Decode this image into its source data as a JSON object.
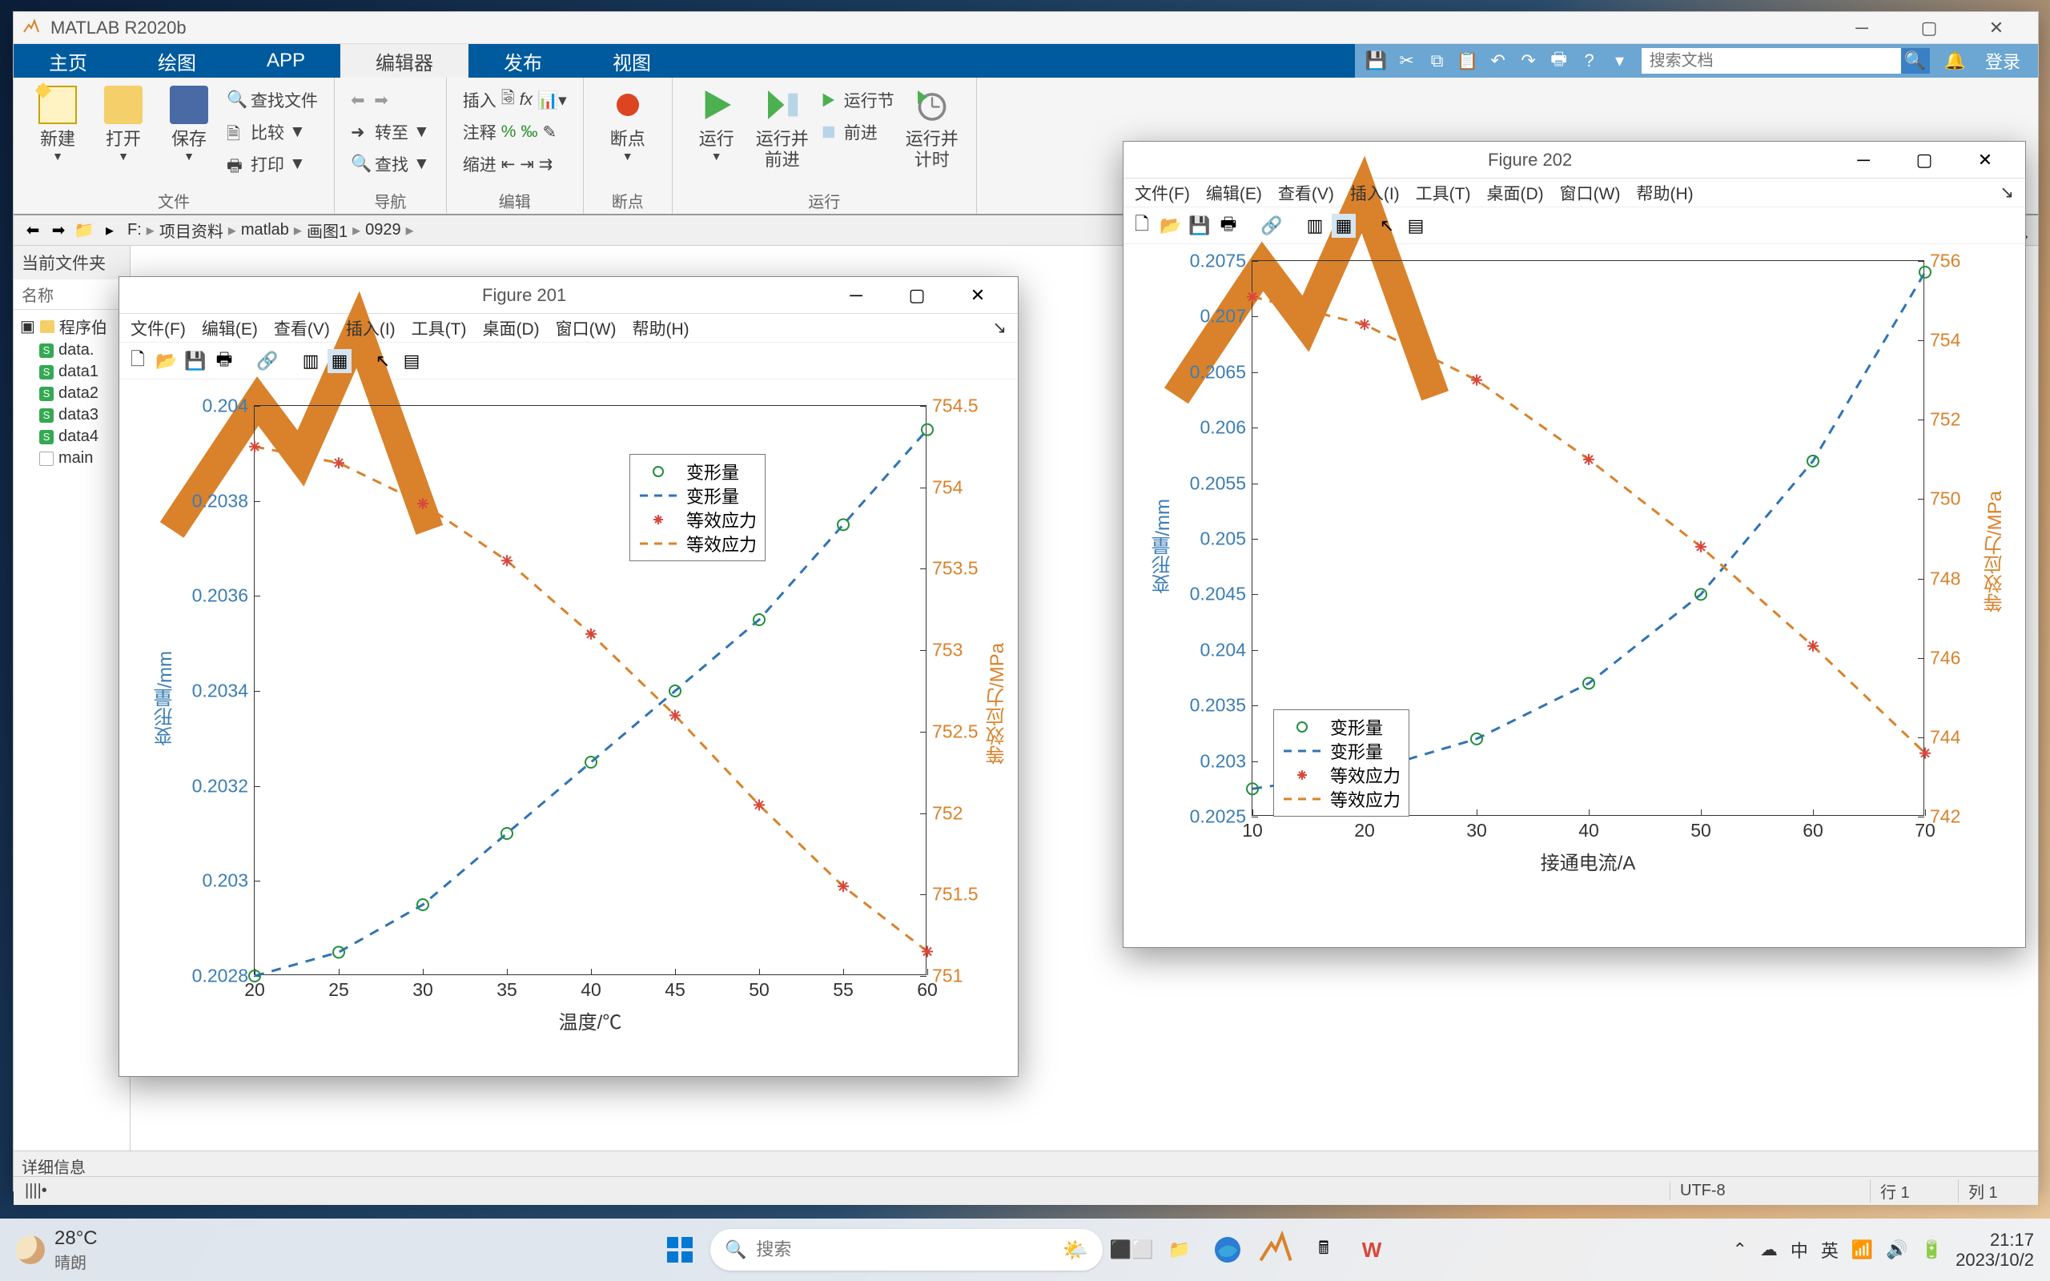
{
  "app": {
    "title": "MATLAB R2020b"
  },
  "tabs": [
    "主页",
    "绘图",
    "APP",
    "编辑器",
    "发布",
    "视图"
  ],
  "active_tab": 3,
  "search_placeholder": "搜索文档",
  "login": "登录",
  "ribbon": {
    "groups": {
      "file": {
        "label": "文件",
        "btns": [
          "新建",
          "打开",
          "保存"
        ],
        "rows": [
          "查找文件",
          "比较",
          "打印"
        ]
      },
      "nav": {
        "label": "导航",
        "rows": [
          "转至",
          "查找"
        ]
      },
      "edit": {
        "label": "编辑",
        "head": [
          "插入",
          "注释",
          "缩进"
        ]
      },
      "break": {
        "label": "断点",
        "btn": "断点"
      },
      "run": {
        "label": "运行",
        "btns": [
          "运行",
          "运行并前进",
          "运行并计时"
        ],
        "rows": [
          "运行节",
          "前进"
        ]
      }
    }
  },
  "path": {
    "drive": "F:",
    "segs": [
      "项目资料",
      "matlab",
      "画图1",
      "0929"
    ]
  },
  "sidebar": {
    "title": "当前文件夹",
    "col": "名称",
    "folder": "程序伯",
    "files": [
      "data.",
      "data1",
      "data2",
      "data3",
      "data4",
      "main"
    ]
  },
  "details": "详细信息",
  "linecol": {
    "encoding": "UTF-8",
    "line": "行 1",
    "col": "列 1"
  },
  "fig201": {
    "title": "Figure 201",
    "menus": [
      "文件(F)",
      "编辑(E)",
      "查看(V)",
      "插入(I)",
      "工具(T)",
      "桌面(D)",
      "窗口(W)",
      "帮助(H)"
    ]
  },
  "fig202": {
    "title": "Figure 202",
    "menus": [
      "文件(F)",
      "编辑(E)",
      "查看(V)",
      "插入(I)",
      "工具(T)",
      "桌面(D)",
      "窗口(W)",
      "帮助(H)"
    ]
  },
  "legend_labels": [
    "变形量",
    "变形量",
    "等效应力",
    "等效应力"
  ],
  "taskbar": {
    "weather": {
      "temp": "28°C",
      "desc": "晴朗"
    },
    "search": "搜索",
    "ime": {
      "lang1": "中",
      "lang2": "英"
    },
    "clock": {
      "time": "21:17",
      "date": "2023/10/2"
    }
  },
  "chart_data": [
    {
      "figure": "201",
      "type": "line+scatter",
      "xlabel": "温度/℃",
      "ylabel_left": "变形量/mm",
      "ylabel_right": "等效应力/MPa",
      "x": [
        20,
        25,
        30,
        35,
        40,
        45,
        50,
        55,
        60
      ],
      "xlim": [
        20,
        60
      ],
      "y_left": [
        0.2028,
        0.20285,
        0.20295,
        0.2031,
        0.20325,
        0.2034,
        0.20355,
        0.20375,
        0.20395
      ],
      "ylim_left": [
        0.2028,
        0.204
      ],
      "yticks_left": [
        0.2028,
        0.203,
        0.2032,
        0.2034,
        0.2036,
        0.2038,
        0.204
      ],
      "y_right": [
        754.25,
        754.15,
        753.9,
        753.55,
        753.1,
        752.6,
        752.05,
        751.55,
        751.15
      ],
      "ylim_right": [
        751,
        754.5
      ],
      "yticks_right": [
        751,
        751.5,
        752,
        752.5,
        753,
        753.5,
        754,
        754.5
      ],
      "series": [
        {
          "name": "变形量",
          "marker": "o",
          "color": "#1f8f3b",
          "axis": "left"
        },
        {
          "name": "变形量",
          "style": "dash",
          "color": "#2f74b5",
          "axis": "left"
        },
        {
          "name": "等效应力",
          "marker": "*",
          "color": "#d9463b",
          "axis": "right"
        },
        {
          "name": "等效应力",
          "style": "dash",
          "color": "#d9822b",
          "axis": "right"
        }
      ]
    },
    {
      "figure": "202",
      "type": "line+scatter",
      "xlabel": "接通电流/A",
      "ylabel_left": "变形量/mm",
      "ylabel_right": "等效应力/MPa",
      "x": [
        10,
        20,
        30,
        40,
        50,
        60,
        70
      ],
      "xlim": [
        10,
        70
      ],
      "y_left": [
        0.20275,
        0.2029,
        0.2032,
        0.2037,
        0.2045,
        0.2057,
        0.2074
      ],
      "ylim_left": [
        0.2025,
        0.2075
      ],
      "yticks_left": [
        0.2025,
        0.203,
        0.2035,
        0.204,
        0.2045,
        0.205,
        0.2055,
        0.206,
        0.2065,
        0.207,
        0.2075
      ],
      "y_right": [
        755.1,
        754.4,
        753.0,
        751.0,
        748.8,
        746.3,
        743.6
      ],
      "ylim_right": [
        742,
        756
      ],
      "yticks_right": [
        742,
        744,
        746,
        748,
        750,
        752,
        754,
        756
      ],
      "series": [
        {
          "name": "变形量",
          "marker": "o",
          "color": "#1f8f3b",
          "axis": "left"
        },
        {
          "name": "变形量",
          "style": "dash",
          "color": "#2f74b5",
          "axis": "left"
        },
        {
          "name": "等效应力",
          "marker": "*",
          "color": "#d9463b",
          "axis": "right"
        },
        {
          "name": "等效应力",
          "style": "dash",
          "color": "#d9822b",
          "axis": "right"
        }
      ]
    }
  ]
}
